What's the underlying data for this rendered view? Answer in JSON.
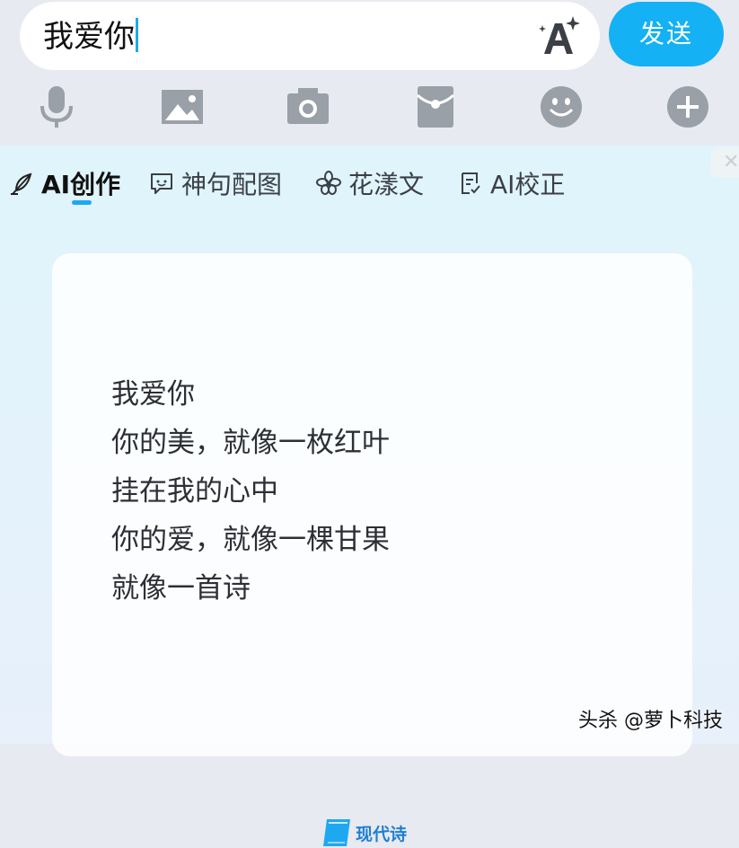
{
  "input": {
    "text": "我爱你",
    "send_label": "发送"
  },
  "toolbar": {
    "icons": [
      "microphone-icon",
      "image-icon",
      "camera-icon",
      "red-packet-icon",
      "emoji-icon",
      "plus-icon"
    ]
  },
  "tabs": [
    {
      "label": "AI创作",
      "icon": "feather-icon",
      "active": true
    },
    {
      "label": "神句配图",
      "icon": "chat-bubble-icon",
      "active": false
    },
    {
      "label": "花漾文",
      "icon": "flower-icon",
      "active": false
    },
    {
      "label": "AI校正",
      "icon": "document-check-icon",
      "active": false
    }
  ],
  "poem": {
    "lines": [
      "我爱你",
      "你的美，就像一枚红叶",
      "挂在我的心中",
      "你的爱，就像一棵甘果",
      "就像一首诗"
    ]
  },
  "style_badge": {
    "label": "现代诗"
  },
  "watermark": "头杀 @萝卜科技",
  "colors": {
    "accent": "#14b1f5",
    "icon_gray": "#9aa0a8"
  }
}
